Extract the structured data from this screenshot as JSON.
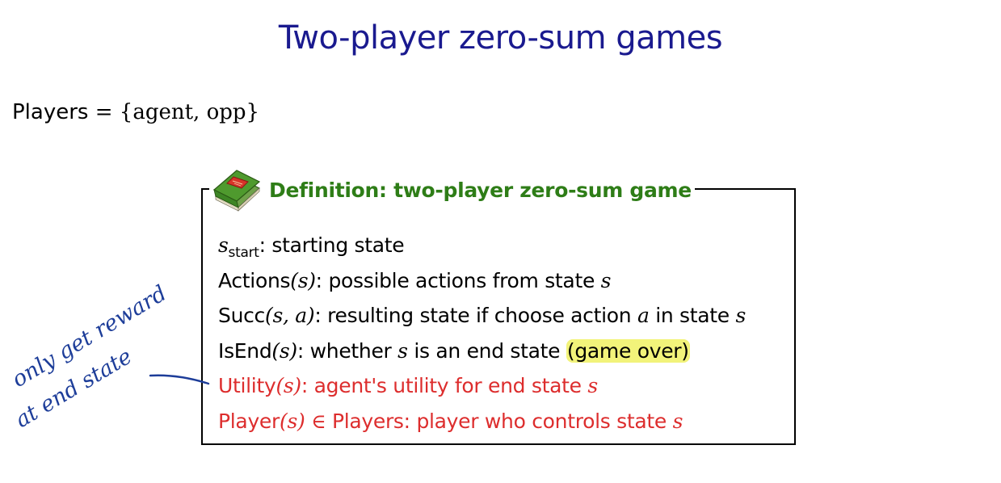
{
  "slide": {
    "title": "Two-player zero-sum games"
  },
  "players": {
    "label": "Players",
    "equals": " = ",
    "set": "{agent, opp}"
  },
  "definition": {
    "icon": "book-icon",
    "title": "Definition: two-player zero-sum game",
    "lines": [
      {
        "name": "s_start",
        "description": ": starting state",
        "highlight": null,
        "color": "#000000"
      },
      {
        "name": "Actions",
        "arg": "(s)",
        "description": ": possible actions from state ",
        "var": "s",
        "color": "#000000"
      },
      {
        "name": "Succ",
        "arg": "(s, a)",
        "description": ": resulting state if choose action ",
        "var": "a",
        "tail": " in state ",
        "tail_var": "s",
        "color": "#000000"
      },
      {
        "name": "IsEnd",
        "arg": "(s)",
        "description": ": whether ",
        "var": "s",
        "tail": " is an end state ",
        "highlight": "(game over)",
        "color": "#000000"
      },
      {
        "name": "Utility",
        "arg": "(s)",
        "description": ": agent's utility for end state ",
        "var": "s",
        "color": "#dd2d2d"
      },
      {
        "name": "Player",
        "arg": "(s)",
        "member": " ∈ ",
        "set_name": "Players",
        "description": ": player who controls state ",
        "var": "s",
        "color": "#dd2d2d"
      }
    ],
    "s_start_var": "s",
    "s_start_sub": "start"
  },
  "annotation": {
    "line1": "only get reward",
    "line2": "at end state",
    "color": "#1d3d99"
  },
  "colors": {
    "title": "#1a1a8f",
    "definition_title": "#2e7d17",
    "emphasis_red": "#dd2d2d",
    "highlight": "#f2f37a"
  }
}
